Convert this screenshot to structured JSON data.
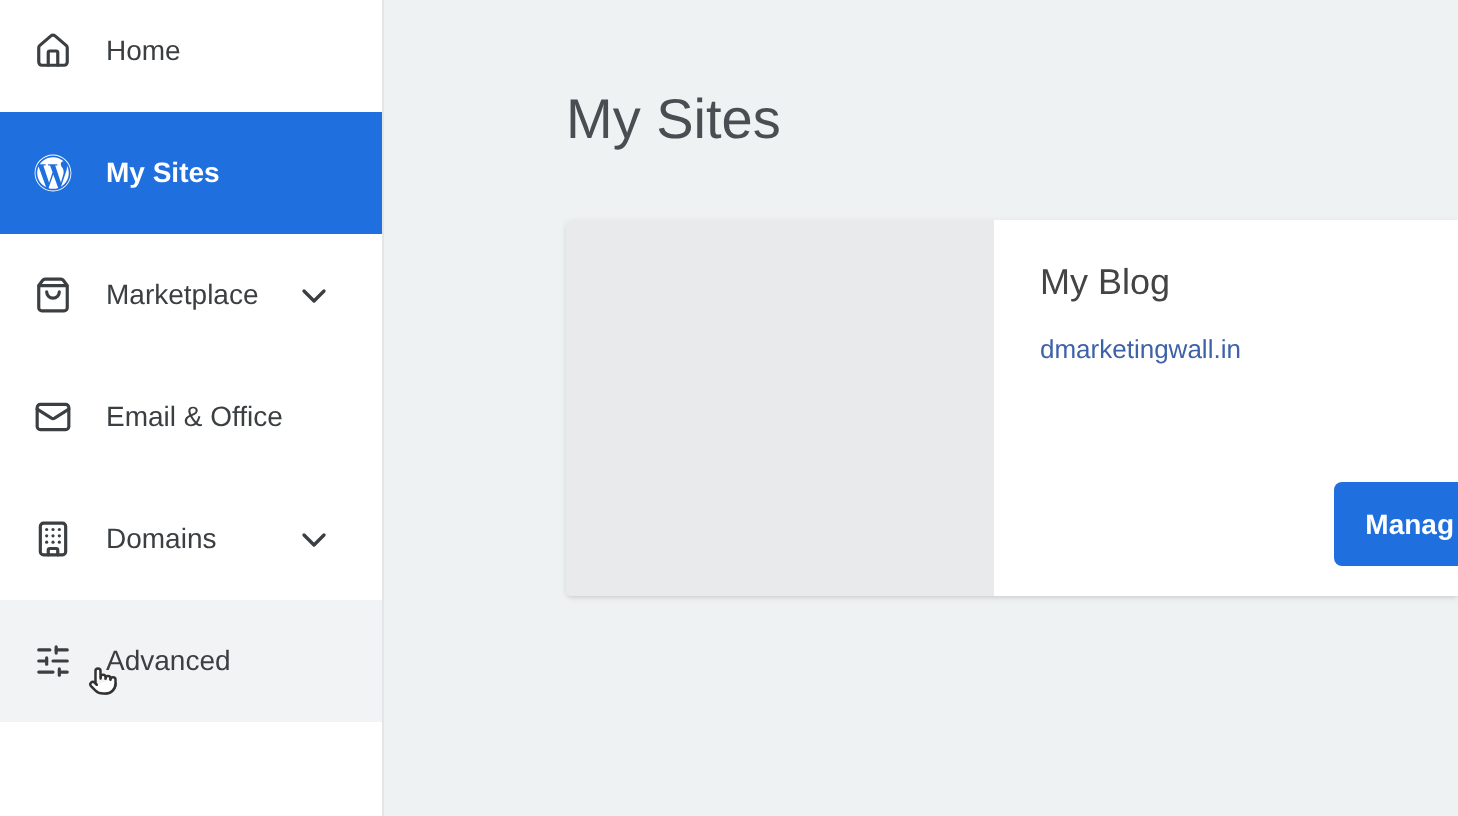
{
  "sidebar": {
    "items": [
      {
        "label": "Home",
        "kind": "home",
        "selected": false,
        "hovered": false,
        "expandable": false
      },
      {
        "label": "My Sites",
        "kind": "wordpress",
        "selected": true,
        "hovered": false,
        "expandable": false
      },
      {
        "label": "Marketplace",
        "kind": "bag",
        "selected": false,
        "hovered": false,
        "expandable": true
      },
      {
        "label": "Email & Office",
        "kind": "mail",
        "selected": false,
        "hovered": false,
        "expandable": false
      },
      {
        "label": "Domains",
        "kind": "building",
        "selected": false,
        "hovered": false,
        "expandable": true
      },
      {
        "label": "Advanced",
        "kind": "sliders",
        "selected": false,
        "hovered": true,
        "expandable": false
      }
    ]
  },
  "page": {
    "title": "My Sites",
    "sites": [
      {
        "name": "My Blog",
        "domain": "dmarketingwall.in",
        "button": "Manag"
      }
    ]
  }
}
